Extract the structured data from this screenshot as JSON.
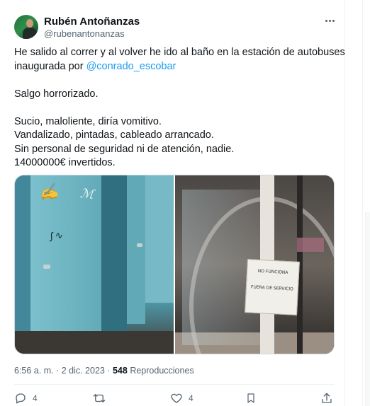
{
  "author": {
    "name": "Rubén Antoñanzas",
    "handle": "@rubenantonanzas"
  },
  "tweet": {
    "line1": "He salido al correr y al volver he ido  al baño en la estación de autobuses",
    "line2_prefix": "inaugurada por ",
    "mention": "@conrado_escobar",
    "line3": "Salgo horrorizado.",
    "line4": "Sucio, maloliente, diría vomitivo.",
    "line5": "Vandalizado, pintadas, cableado arrancado.",
    "line6": "Sin personal de seguridad ni de atención, nadie.",
    "line7": "14000000€ invertidos."
  },
  "media": {
    "left_photo_icon": "toilet-stalls-photo",
    "right_photo_icon": "revolving-door-photo",
    "sign_line1": "NO FUNCIONA",
    "sign_line2": "FUERA DE SERVICIO"
  },
  "meta": {
    "time": "6:56 a. m.",
    "separator": " · ",
    "date": "2 dic. 2023",
    "views_count": "548",
    "views_label": " Reproducciones"
  },
  "actions": {
    "reply_icon": "reply-icon",
    "reply_count": "4",
    "retweet_icon": "retweet-icon",
    "like_icon": "heart-icon",
    "like_count": "4",
    "bookmark_icon": "bookmark-icon",
    "share_icon": "share-icon"
  },
  "colors": {
    "text": "#0f1419",
    "muted": "#536471",
    "link": "#1d9bf0",
    "border": "#eff3f4"
  }
}
